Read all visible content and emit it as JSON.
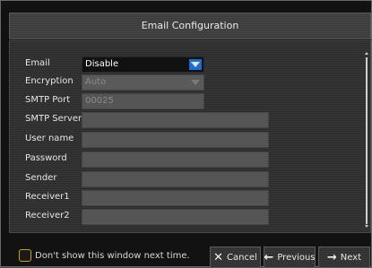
{
  "dialog": {
    "title": "Email Configuration"
  },
  "form": {
    "email": {
      "label": "Email",
      "value": "Disable"
    },
    "encryption": {
      "label": "Encryption",
      "value": "Auto"
    },
    "smtp_port": {
      "label": "SMTP Port",
      "value": "00025"
    },
    "smtp_server": {
      "label": "SMTP Server",
      "value": ""
    },
    "user_name": {
      "label": "User name",
      "value": ""
    },
    "password": {
      "label": "Password",
      "value": ""
    },
    "sender": {
      "label": "Sender",
      "value": ""
    },
    "receiver1": {
      "label": "Receiver1",
      "value": ""
    },
    "receiver2": {
      "label": "Receiver2",
      "value": ""
    }
  },
  "footer": {
    "dont_show_label": "Don't show this window next time.",
    "cancel_label": "Cancel",
    "previous_label": "Previous",
    "next_label": "Next"
  },
  "colors": {
    "accent": "#1b6fd1",
    "checkbox_border": "#c8a400"
  },
  "icons": {
    "cancel": "close-icon",
    "previous": "arrow-left-icon",
    "next": "arrow-right-icon",
    "dropdown": "chevron-down-icon"
  }
}
